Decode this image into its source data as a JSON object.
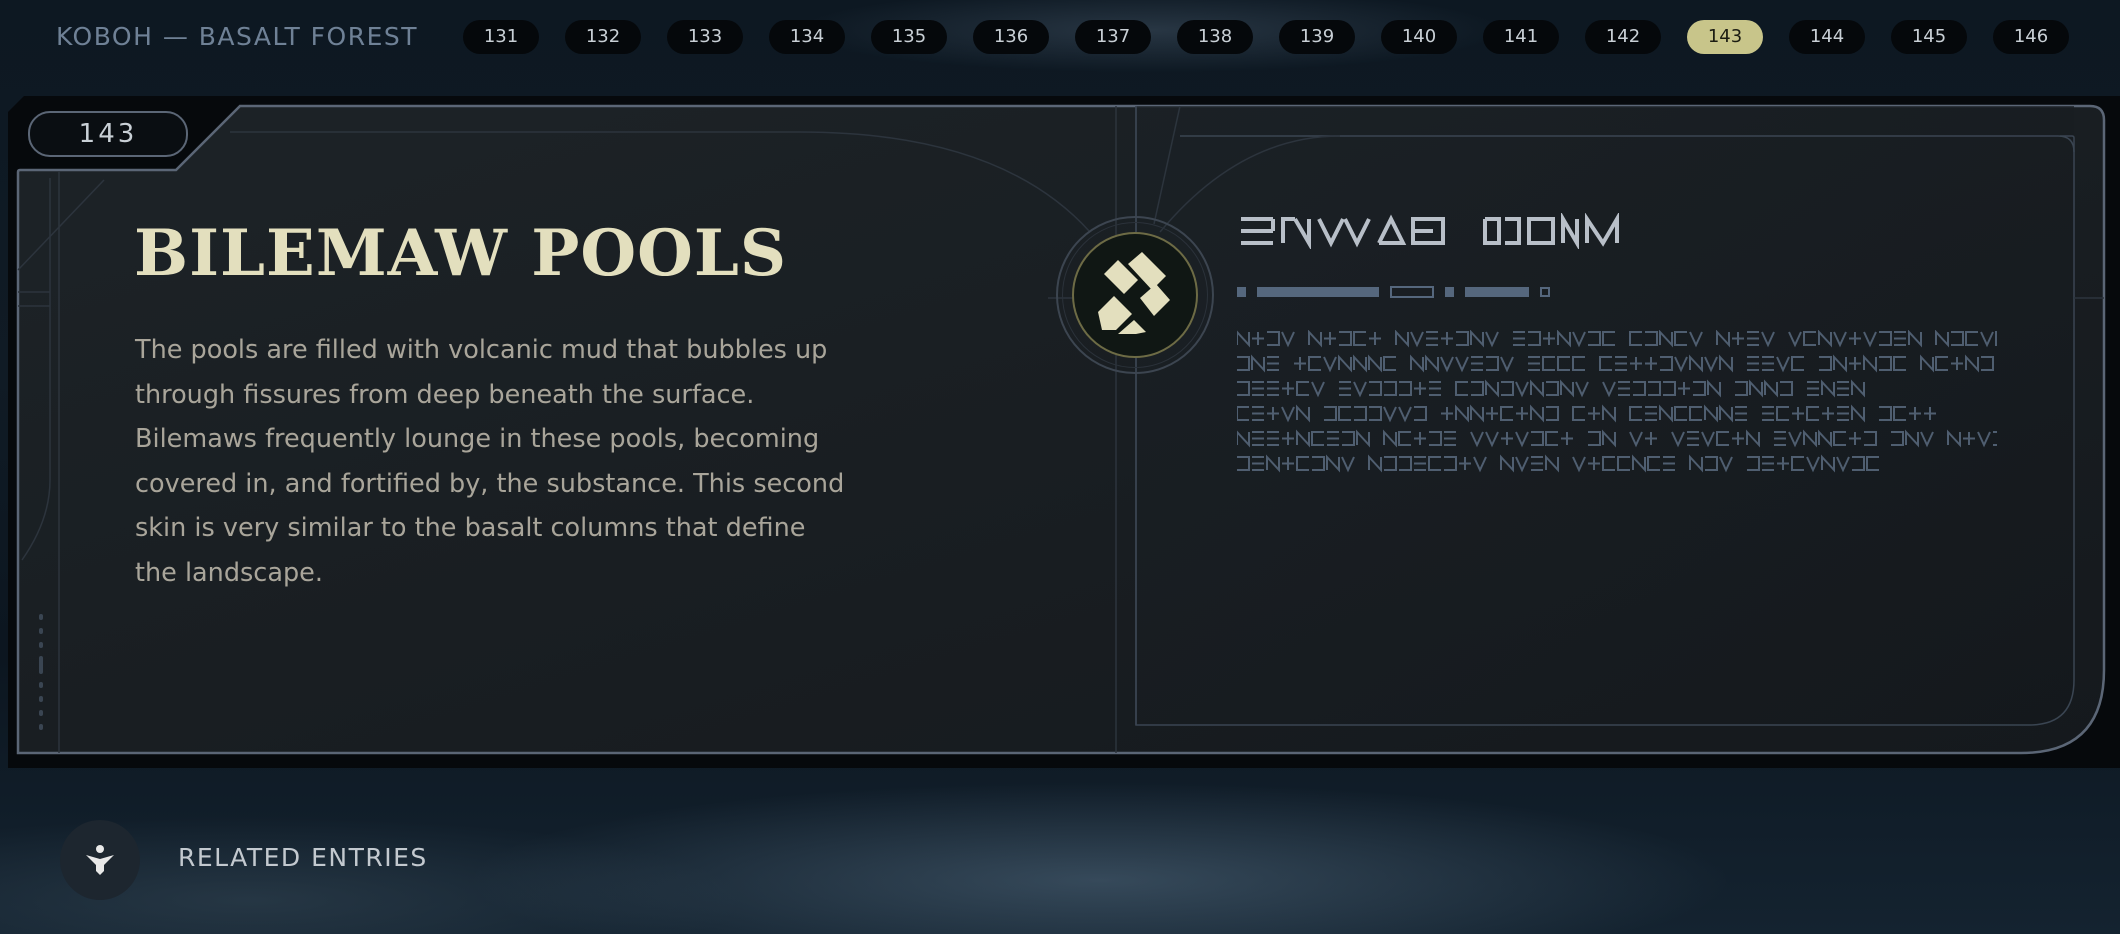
{
  "header": {
    "location": "KOBOH — BASALT FOREST",
    "pages": [
      "131",
      "132",
      "133",
      "134",
      "135",
      "136",
      "137",
      "138",
      "139",
      "140",
      "141",
      "142",
      "143",
      "144",
      "145",
      "146"
    ],
    "active_page": "143"
  },
  "entry": {
    "number": "143",
    "title": "BILEMAW POOLS",
    "body": "The pools are filled with volcanic mud that bubbles up through fissures from deep beneath the surface. Bilemaws frequently lounge in these pools, becoming covered in, and fortified by, the substance. This second skin is very similar to the basalt columns that define the landscape.",
    "emblem_icon": "databank-category-icon",
    "aurebesh_title_icon": "aurebesh-title-glyphs",
    "aurebesh_text_icon": "aurebesh-body-glyphs"
  },
  "footer": {
    "related_label": "RELATED ENTRIES",
    "related_icon": "related-entries-icon"
  },
  "colors": {
    "title": "#e3dfbe",
    "body_text": "#a9a59a",
    "active_page": "#c8c58a",
    "frame": "#5b6676",
    "aurebesh": "#4f5e70"
  }
}
